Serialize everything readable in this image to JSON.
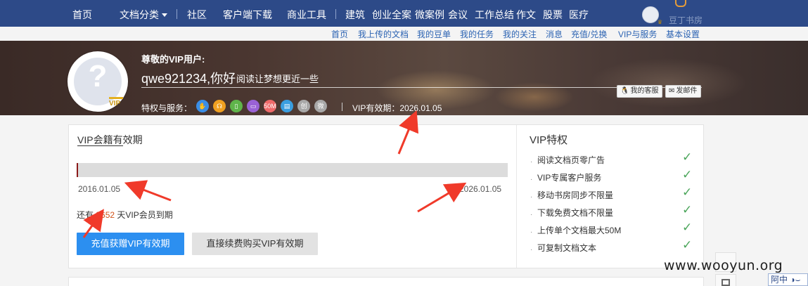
{
  "topnav": {
    "items": [
      {
        "label": "首页",
        "key": "home"
      },
      {
        "label": "文档分类",
        "key": "doc-category",
        "has_dropdown": true
      },
      {
        "label": "社区",
        "key": "community"
      },
      {
        "label": "客户端下载",
        "key": "client-download"
      },
      {
        "label": "商业工具",
        "key": "business-tools"
      },
      {
        "label": "建筑",
        "key": "architecture"
      },
      {
        "label": "创业全案",
        "key": "startup"
      },
      {
        "label": "微案例",
        "key": "micro-case"
      },
      {
        "label": "会议",
        "key": "meeting"
      },
      {
        "label": "工作总结",
        "key": "work-summary"
      },
      {
        "label": "作文",
        "key": "essay"
      },
      {
        "label": "股票",
        "key": "stock"
      },
      {
        "label": "医疗",
        "key": "medical"
      }
    ],
    "bookroom_label": "豆丁书房"
  },
  "subnav": {
    "links": [
      "首页",
      "我上传的文档",
      "我的豆单",
      "我的任务",
      "我的关注",
      "消息",
      "充值/兑换",
      "VIP与服务",
      "基本设置"
    ]
  },
  "banner": {
    "greeting": "尊敬的VIP用户:",
    "username_line": "qwe921234,你好",
    "slogan": "阅读让梦想更近一些",
    "privileges_label": "特权与服务：",
    "privilege_icons": [
      {
        "icon": "hand-icon",
        "color": "#3a8ee6",
        "glyph": "✋"
      },
      {
        "icon": "headset-icon",
        "color": "#f0a020",
        "glyph": "☊"
      },
      {
        "icon": "phone-icon",
        "color": "#5fb44a",
        "glyph": "▯"
      },
      {
        "icon": "monitor-icon",
        "color": "#9a62d6",
        "glyph": "▭"
      },
      {
        "icon": "storage-50m-icon",
        "color": "#f06a6a",
        "glyph": "50M"
      },
      {
        "icon": "document-icon",
        "color": "#3a9ee0",
        "glyph": "▤"
      },
      {
        "icon": "copy-icon",
        "color": "#a8a8a8",
        "glyph": "创"
      },
      {
        "icon": "wechat-icon",
        "color": "#a8a8a8",
        "glyph": "微"
      }
    ],
    "validity": "VIP有效期：2026.01.05",
    "my_service_button": "我的客服",
    "send_mail_button": "发邮件"
  },
  "avatar": {
    "badge": "VIP"
  },
  "membership": {
    "title": "VIP会籍有效期",
    "start_date": "2016.01.05",
    "end_date": "2026.01.05",
    "progress_fraction": 0.0,
    "remaining_prefix": "还有",
    "remaining_days": "3652",
    "remaining_suffix": "天VIP会员到期",
    "primary_button": "充值获赠VIP有效期",
    "secondary_button": "直接续费购买VIP有效期"
  },
  "vip_privileges": {
    "title": "VIP特权",
    "items": [
      "阅读文档页零广告",
      "VIP专属客户服务",
      "移动书房同步不限量",
      "下载免费文档不限量",
      "上传单个文档最大50M",
      "可复制文档文本"
    ]
  },
  "watermark": "www.wooyun.org",
  "ime": {
    "label": "阿中"
  },
  "colors": {
    "nav_bg": "#2d4a88",
    "accent_blue": "#2c8ff0",
    "highlight": "#d0541c",
    "annotation_arrow": "#f03a2a",
    "check_green": "#4aa55a"
  }
}
